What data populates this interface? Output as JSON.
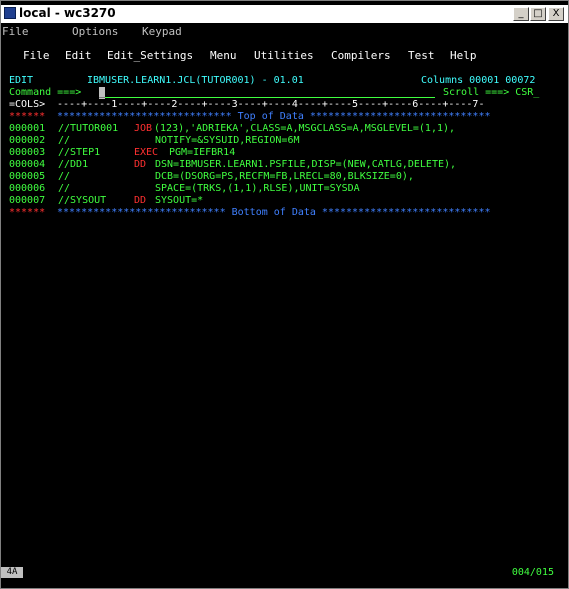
{
  "window": {
    "title": "local - wc3270",
    "min": "_",
    "max": "□",
    "close": "X"
  },
  "menu": {
    "file": "File",
    "options": "Options",
    "keypad": "Keypad"
  },
  "action_bar": [
    "File",
    "Edit",
    "Edit_Settings",
    "Menu",
    "Utilities",
    "Compilers",
    "Test",
    "Help"
  ],
  "header": {
    "mode": "EDIT",
    "dataset": "IBMUSER.LEARN1.JCL(TUTOR001) - 01.01",
    "columns": "Columns 00001 00072",
    "command_label": "Command ===>",
    "command_value": "_",
    "scroll_label": "Scroll ===> CSR_",
    "cols_label": "=COLS>",
    "ruler": " ----+----1----+----2----+----3----+----4----+----5----+----6----+----7-"
  },
  "lines": [
    {
      "num": "******",
      "text": " ***************************** Top of Data ******************************"
    },
    {
      "num": "000001",
      "label": "//TUTOR001",
      "op": "JOB",
      "rest": "(123),'ADRIEKA',CLASS=A,MSGCLASS=A,MSGLEVEL=(1,1),"
    },
    {
      "num": "000002",
      "label": "//",
      "op": "",
      "rest": "NOTIFY=&SYSUID,REGION=6M"
    },
    {
      "num": "000003",
      "label": "//STEP1",
      "op": "EXEC",
      "rest": "PGM=IEFBR14"
    },
    {
      "num": "000004",
      "label": "//DD1",
      "op": "DD",
      "rest": "DSN=IBMUSER.LEARN1.PSFILE,DISP=(NEW,CATLG,DELETE),"
    },
    {
      "num": "000005",
      "label": "//",
      "op": "",
      "rest": "DCB=(DSORG=PS,RECFM=FB,LRECL=80,BLKSIZE=0),"
    },
    {
      "num": "000006",
      "label": "//",
      "op": "",
      "rest": "SPACE=(TRKS,(1,1),RLSE),UNIT=SYSDA"
    },
    {
      "num": "000007",
      "label": "//SYSOUT",
      "op": "DD",
      "rest": "SYSOUT=*"
    },
    {
      "num": "******",
      "text": " **************************** Bottom of Data ****************************"
    }
  ],
  "status": {
    "left": "4A",
    "position": "004/015"
  }
}
